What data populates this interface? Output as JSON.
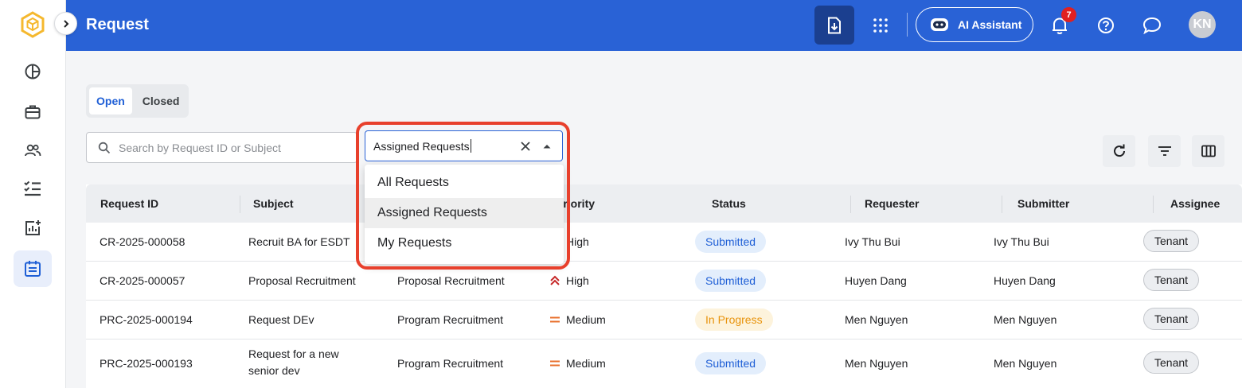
{
  "header": {
    "title": "Request",
    "ai_assistant_label": "AI Assistant",
    "notification_count": "7",
    "avatar_initials": "KN"
  },
  "colors": {
    "brand_blue": "#2962d6",
    "submitted_bg": "#e3eefc",
    "submitted_text": "#1f5fd6",
    "in_progress_bg": "#fdf3dc",
    "in_progress_text": "#e8930c",
    "high_priority": "#c62828",
    "medium_priority": "#e8702c",
    "highlight_border": "#e8402c"
  },
  "sidebar": {
    "items": [
      {
        "icon": "pie-chart-icon"
      },
      {
        "icon": "briefcase-icon"
      },
      {
        "icon": "users-icon"
      },
      {
        "icon": "checklist-icon"
      },
      {
        "icon": "report-add-icon"
      },
      {
        "icon": "calendar-list-icon",
        "active": true
      }
    ]
  },
  "tabs": [
    {
      "label": "Open",
      "active": true
    },
    {
      "label": "Closed",
      "active": false
    }
  ],
  "search": {
    "placeholder": "Search by Request ID or Subject"
  },
  "filter_select": {
    "value": "Assigned Requests",
    "options": [
      "All Requests",
      "Assigned Requests",
      "My Requests"
    ],
    "hovered": "Assigned Requests"
  },
  "table": {
    "columns": [
      "Request ID",
      "Subject",
      "Priority",
      "Status",
      "Requester",
      "Submitter",
      "Assignee"
    ],
    "rows": [
      {
        "id": "CR-2025-000058",
        "subject": "Recruit BA for ESDT",
        "type": "",
        "priority": "High",
        "status": "Submitted",
        "requester": "Ivy Thu Bui",
        "submitter": "Ivy Thu Bui",
        "assignee": "Tenant"
      },
      {
        "id": "CR-2025-000057",
        "subject": "Proposal Recruitment",
        "type": "Proposal Recruitment",
        "priority": "High",
        "status": "Submitted",
        "requester": "Huyen Dang",
        "submitter": "Huyen Dang",
        "assignee": "Tenant"
      },
      {
        "id": "PRC-2025-000194",
        "subject": "Request DEv",
        "type": "Program Recruitment",
        "priority": "Medium",
        "status": "In Progress",
        "requester": "Men Nguyen",
        "submitter": "Men Nguyen",
        "assignee": "Tenant"
      },
      {
        "id": "PRC-2025-000193",
        "subject_line1": "Request for a new",
        "subject_line2": "senior dev",
        "type": "Program Recruitment",
        "priority": "Medium",
        "status": "Submitted",
        "requester": "Men Nguyen",
        "submitter": "Men Nguyen",
        "assignee": "Tenant"
      }
    ]
  }
}
